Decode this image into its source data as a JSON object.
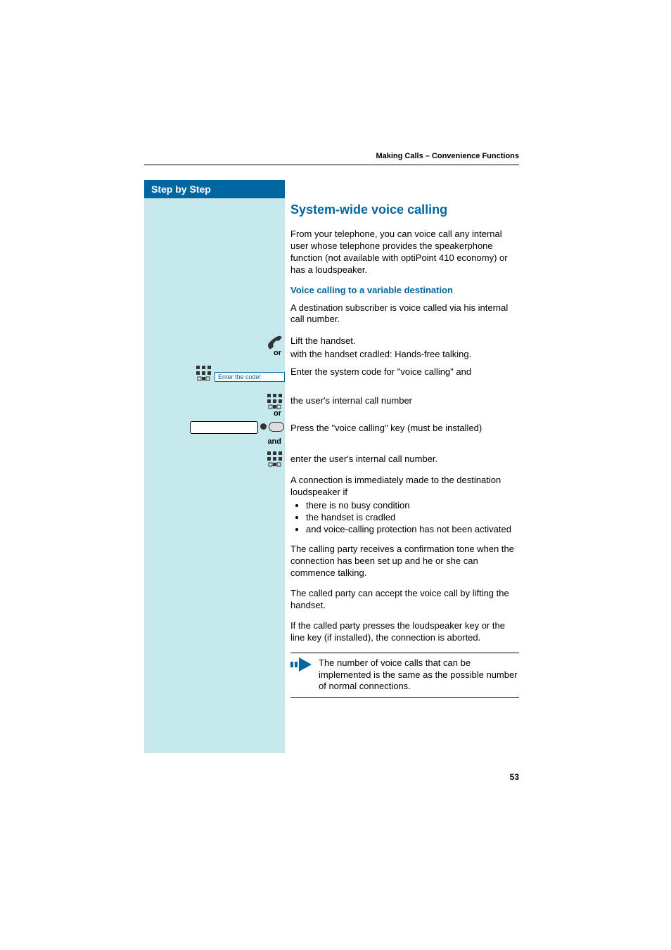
{
  "header": {
    "running_title": "Making Calls – Convenience Functions"
  },
  "sidebar": {
    "title": "Step by Step"
  },
  "section": {
    "title": "System-wide voice calling",
    "intro": "From your telephone, you can voice call any internal user whose telephone provides  the speakerphone function (not available with optiPoint 410 economy) or has a loudspeaker.",
    "sub_heading": "Voice calling to a variable destination",
    "sub_intro": "A destination subscriber is voice called via his internal call number."
  },
  "steps": {
    "lift_handset": "Lift the handset.",
    "or1": "or",
    "hands_free": "with the handset cradled: Hands-free talking.",
    "enter_code": "Enter the system code for \"voice calling\" and",
    "code_prompt": "Enter the code!",
    "internal_number_1": "the user's internal call number",
    "or2": "or",
    "press_key": "Press the \"voice calling\" key (must be installed)",
    "and": "and",
    "internal_number_2": "enter the user's internal call number."
  },
  "after": {
    "connection_intro": "A connection is immediately made to the destination loudspeaker if",
    "bullets": [
      "there is no busy condition",
      "the handset is cradled",
      "and voice-calling protection has not been activated"
    ],
    "confirmation": "The calling party receives a confirmation tone when the connection has been set up and he or she can commence talking.",
    "accept": "The called party can accept the voice call by lifting the handset.",
    "abort": "If the called party presses the loudspeaker key or the line key (if installed), the connection is aborted.",
    "note": "The number of voice calls that can be implemented is the same as the possible number of normal connections."
  },
  "page_number": "53"
}
